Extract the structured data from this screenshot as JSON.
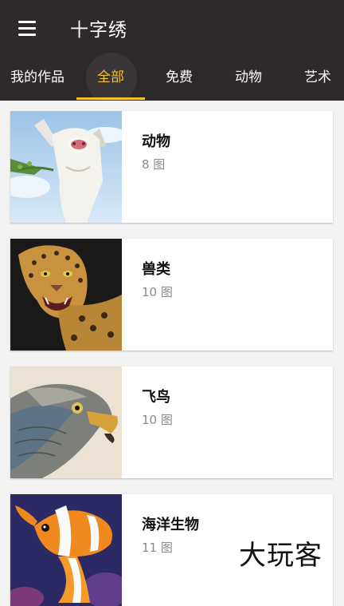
{
  "appbar": {
    "title": "十字绣"
  },
  "tabs": [
    {
      "label": "我的作品"
    },
    {
      "label": "全部",
      "active": true
    },
    {
      "label": "免费"
    },
    {
      "label": "动物"
    },
    {
      "label": "艺术"
    }
  ],
  "categories": [
    {
      "name": "动物",
      "count": "8 图",
      "image": "goat"
    },
    {
      "name": "兽类",
      "count": "10 图",
      "image": "leopard"
    },
    {
      "name": "飞鸟",
      "count": "10 图",
      "image": "eagle"
    },
    {
      "name": "海洋生物",
      "count": "11 图",
      "image": "clownfish"
    }
  ],
  "watermark": "大玩客",
  "colors": {
    "appbar": "#2e2a2c",
    "accent": "#f2c230",
    "background": "#f2f2f2"
  },
  "icons": {
    "menu": "hamburger-menu-icon"
  }
}
